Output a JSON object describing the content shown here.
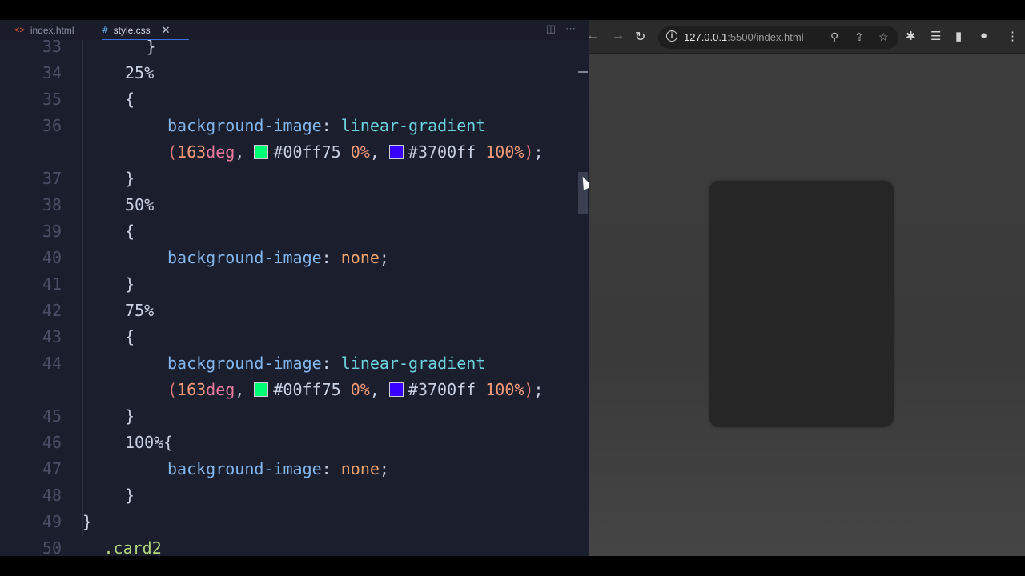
{
  "editor": {
    "tabs": [
      {
        "label": "index.html",
        "icon": "<>"
      },
      {
        "label": "style.css",
        "icon": "#"
      }
    ],
    "tab_close": "✕",
    "lines": [
      {
        "num": "33",
        "indent": 3,
        "tokens": [
          {
            "t": "}",
            "c": "brace"
          }
        ]
      },
      {
        "num": "34",
        "indent": 2,
        "tokens": [
          {
            "t": "25%",
            "c": "pct"
          }
        ]
      },
      {
        "num": "35",
        "indent": 2,
        "tokens": [
          {
            "t": "{",
            "c": "brace"
          }
        ]
      },
      {
        "num": "36",
        "indent": 4,
        "tokens": [
          {
            "t": "background-image",
            "c": "prop"
          },
          {
            "t": ": ",
            "c": "punc"
          },
          {
            "t": "linear-gradient",
            "c": "func"
          }
        ]
      },
      {
        "num": "",
        "indent": 4,
        "tokens": [
          {
            "t": "(",
            "c": "paren"
          },
          {
            "t": "163",
            "c": "num"
          },
          {
            "t": "deg",
            "c": "unit"
          },
          {
            "t": ", ",
            "c": "punc"
          },
          {
            "swatch": "#00ff75"
          },
          {
            "t": "#00ff75",
            "c": "hex"
          },
          {
            "t": " 0%",
            "c": "num"
          },
          {
            "t": ", ",
            "c": "punc"
          },
          {
            "swatch": "#3700ff"
          },
          {
            "t": "#3700ff",
            "c": "hex"
          },
          {
            "t": " 100%",
            "c": "num"
          },
          {
            "t": ")",
            "c": "paren"
          },
          {
            "t": ";",
            "c": "punc"
          }
        ]
      },
      {
        "num": "37",
        "indent": 2,
        "tokens": [
          {
            "t": "}",
            "c": "brace"
          }
        ]
      },
      {
        "num": "38",
        "indent": 2,
        "tokens": [
          {
            "t": "50%",
            "c": "pct"
          }
        ]
      },
      {
        "num": "39",
        "indent": 2,
        "tokens": [
          {
            "t": "{",
            "c": "brace"
          }
        ]
      },
      {
        "num": "40",
        "indent": 4,
        "tokens": [
          {
            "t": "background-image",
            "c": "prop"
          },
          {
            "t": ": ",
            "c": "punc"
          },
          {
            "t": "none",
            "c": "kw"
          },
          {
            "t": ";",
            "c": "punc"
          }
        ]
      },
      {
        "num": "41",
        "indent": 2,
        "tokens": [
          {
            "t": "}",
            "c": "brace"
          }
        ]
      },
      {
        "num": "42",
        "indent": 2,
        "tokens": [
          {
            "t": "75%",
            "c": "pct"
          }
        ]
      },
      {
        "num": "43",
        "indent": 2,
        "tokens": [
          {
            "t": "{",
            "c": "brace"
          }
        ]
      },
      {
        "num": "44",
        "indent": 4,
        "tokens": [
          {
            "t": "background-image",
            "c": "prop"
          },
          {
            "t": ": ",
            "c": "punc"
          },
          {
            "t": "linear-gradient",
            "c": "func"
          }
        ]
      },
      {
        "num": "",
        "indent": 4,
        "tokens": [
          {
            "t": "(",
            "c": "paren"
          },
          {
            "t": "163",
            "c": "num"
          },
          {
            "t": "deg",
            "c": "unit"
          },
          {
            "t": ", ",
            "c": "punc"
          },
          {
            "swatch": "#00ff75"
          },
          {
            "t": "#00ff75",
            "c": "hex"
          },
          {
            "t": " 0%",
            "c": "num"
          },
          {
            "t": ", ",
            "c": "punc"
          },
          {
            "swatch": "#3700ff"
          },
          {
            "t": "#3700ff",
            "c": "hex"
          },
          {
            "t": " 100%",
            "c": "num"
          },
          {
            "t": ")",
            "c": "paren"
          },
          {
            "t": ";",
            "c": "punc"
          }
        ]
      },
      {
        "num": "45",
        "indent": 2,
        "tokens": [
          {
            "t": "}",
            "c": "brace"
          }
        ]
      },
      {
        "num": "46",
        "indent": 2,
        "tokens": [
          {
            "t": "100%",
            "c": "pct"
          },
          {
            "t": "{",
            "c": "brace"
          }
        ]
      },
      {
        "num": "47",
        "indent": 4,
        "tokens": [
          {
            "t": "background-image",
            "c": "prop"
          },
          {
            "t": ": ",
            "c": "punc"
          },
          {
            "t": "none",
            "c": "kw"
          },
          {
            "t": ";",
            "c": "punc"
          }
        ]
      },
      {
        "num": "48",
        "indent": 2,
        "tokens": [
          {
            "t": "}",
            "c": "brace"
          }
        ]
      },
      {
        "num": "49",
        "indent": 0,
        "tokens": [
          {
            "t": "}",
            "c": "brace"
          }
        ]
      },
      {
        "num": "50",
        "indent": 1,
        "tokens": [
          {
            "t": ".card2",
            "c": "sel"
          }
        ]
      }
    ]
  },
  "browser": {
    "url_host": "127.0.0.1",
    "url_path": ":5500/index.html",
    "icons": [
      "back-arrow-icon",
      "forward-arrow-icon",
      "reload-icon",
      "site-info-icon",
      "zoom-icon",
      "share-icon",
      "bookmark-star-icon",
      "extensions-puzzle-icon",
      "reading-list-icon",
      "side-panel-icon",
      "profile-icon",
      "menu-dots-icon"
    ]
  },
  "colors": {
    "editor_bg": "#1b1f2d",
    "browser_bg": "#3c3c3c",
    "card_bg": "#262626",
    "swatch_green": "#00ff75",
    "swatch_blue": "#3700ff"
  }
}
